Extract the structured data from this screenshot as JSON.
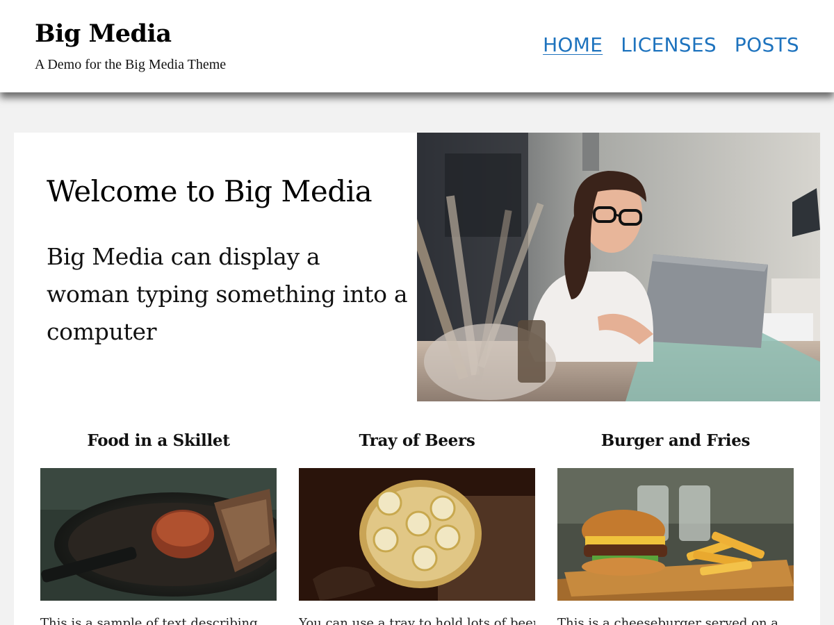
{
  "header": {
    "site_title": "Big Media",
    "tagline": "A Demo for the Big Media Theme",
    "nav": [
      {
        "label": "HOME",
        "current": true
      },
      {
        "label": "LICENSES",
        "current": false
      },
      {
        "label": "POSTS",
        "current": false
      }
    ]
  },
  "hero": {
    "heading": "Welcome to Big Media",
    "description": "Big Media can display a woman typing something into a computer",
    "image_icon": "woman-laptop-photo"
  },
  "posts": [
    {
      "title": "Food in a Skillet",
      "excerpt": "This is a sample of text describing",
      "image_icon": "skillet-photo"
    },
    {
      "title": "Tray of Beers",
      "excerpt": "You can use a tray to hold lots of beer",
      "image_icon": "beer-tray-photo"
    },
    {
      "title": "Burger and Fries",
      "excerpt": "This is a cheeseburger served on a",
      "image_icon": "burger-photo"
    }
  ],
  "colors": {
    "link": "#1e73be",
    "page_background": "#f2f2f2",
    "card_background": "#ffffff"
  }
}
